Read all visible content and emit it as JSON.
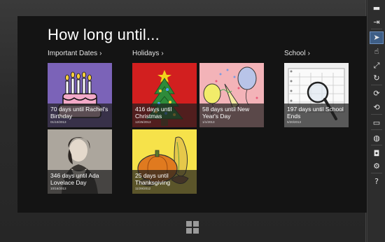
{
  "app": {
    "title": "How long until..."
  },
  "groups": [
    {
      "label": "Important Dates",
      "chevron": "›"
    },
    {
      "label": "Holidays",
      "chevron": "›"
    },
    {
      "label": "School",
      "chevron": "›"
    }
  ],
  "tiles": {
    "rachel": {
      "title": "70 days until Rachel's Birthday",
      "date": "01/10/2013"
    },
    "christmas": {
      "title": "416 days until Christmas",
      "date": "12/25/2013"
    },
    "newyear": {
      "title": "58 days until New Year's Day",
      "date": "1/1/2013"
    },
    "school": {
      "title": "197 days until School Ends",
      "date": "5/20/2013"
    },
    "ada": {
      "title": "346 days until Ada Lovelace Day",
      "date": "10/16/2013"
    },
    "thanksgiving": {
      "title": "25 days until Thanksgiving",
      "date": "11/29/2012"
    }
  },
  "toolbar": {
    "icons": [
      "minimize-icon",
      "pin-icon",
      "mouse-mode-icon",
      "touch-mode-icon",
      "pinch-zoom-icon",
      "rotate-icon",
      "rotate-clockwise-icon",
      "rotate-counterclockwise-icon",
      "resolution-icon",
      "location-icon",
      "screenshot-icon",
      "settings-icon",
      "help-icon"
    ],
    "glyphs": {
      "minimize": "▬",
      "pin": "⇥",
      "mouse": "➤",
      "touch": "☝",
      "pinch": "⤢",
      "rotate": "↻",
      "rotate_cw": "⟳",
      "rotate_ccw": "⟲",
      "resolution": "▭",
      "location": "◍",
      "camera": "◘",
      "settings": "⚙",
      "help": "?"
    }
  }
}
